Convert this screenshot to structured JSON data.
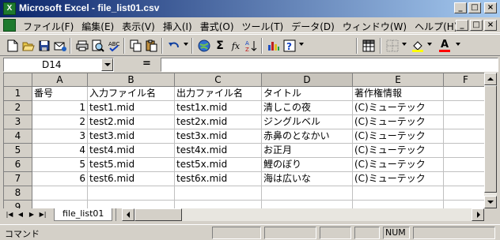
{
  "window": {
    "app_icon": "excel-icon",
    "title": "Microsoft Excel - file_list01.csv",
    "min_glyph": "_",
    "max_glyph": "□",
    "close_glyph": "×"
  },
  "menu": {
    "items": [
      "ファイル(F)",
      "編集(E)",
      "表示(V)",
      "挿入(I)",
      "書式(O)",
      "ツール(T)",
      "データ(D)",
      "ウィンドウ(W)",
      "ヘルプ(H)"
    ]
  },
  "toolbar": {
    "icons": [
      "new-icon",
      "open-icon",
      "save-icon",
      "email-icon",
      "print-icon",
      "print-preview-icon",
      "spelling-icon",
      "copy-icon",
      "paste-icon",
      "undo-icon",
      "hyperlink-icon",
      "autosum-icon",
      "function-icon",
      "sort-ascending-icon",
      "chart-wizard-icon",
      "help-icon",
      "freeze-panes-icon",
      "borders-icon",
      "fill-color-icon",
      "font-color-icon"
    ],
    "sigma": "Σ",
    "fx": "fx",
    "font_color_letter": "A",
    "help_glyph": "?"
  },
  "formula": {
    "name_box": "D14",
    "equals": "=",
    "content": ""
  },
  "grid": {
    "columns": [
      "A",
      "B",
      "C",
      "D",
      "E",
      "F"
    ],
    "active_column": "D",
    "rows": [
      {
        "n": "1",
        "cells": [
          "番号",
          "入力ファイル名",
          "出力ファイル名",
          "タイトル",
          "著作権情報",
          ""
        ]
      },
      {
        "n": "2",
        "cells": [
          "1",
          "test1.mid",
          "test1x.mid",
          "清しこの夜",
          "(C)ミューテック",
          ""
        ]
      },
      {
        "n": "3",
        "cells": [
          "2",
          "test2.mid",
          "test2x.mid",
          "ジングルベル",
          "(C)ミューテック",
          ""
        ]
      },
      {
        "n": "4",
        "cells": [
          "3",
          "test3.mid",
          "test3x.mid",
          "赤鼻のとなかい",
          "(C)ミューテック",
          ""
        ]
      },
      {
        "n": "5",
        "cells": [
          "4",
          "test4.mid",
          "test4x.mid",
          "お正月",
          "(C)ミューテック",
          ""
        ]
      },
      {
        "n": "6",
        "cells": [
          "5",
          "test5.mid",
          "test5x.mid",
          "鯉のぼり",
          "(C)ミューテック",
          ""
        ]
      },
      {
        "n": "7",
        "cells": [
          "6",
          "test6.mid",
          "test6x.mid",
          "海は広いな",
          "(C)ミューテック",
          ""
        ]
      },
      {
        "n": "8",
        "cells": [
          "",
          "",
          "",
          "",
          "",
          ""
        ]
      },
      {
        "n": "9",
        "cells": [
          "",
          "",
          "",
          "",
          "",
          ""
        ]
      }
    ]
  },
  "sheets": {
    "tabs": [
      "file_list01"
    ]
  },
  "status": {
    "mode": "コマンド",
    "num": "NUM"
  }
}
